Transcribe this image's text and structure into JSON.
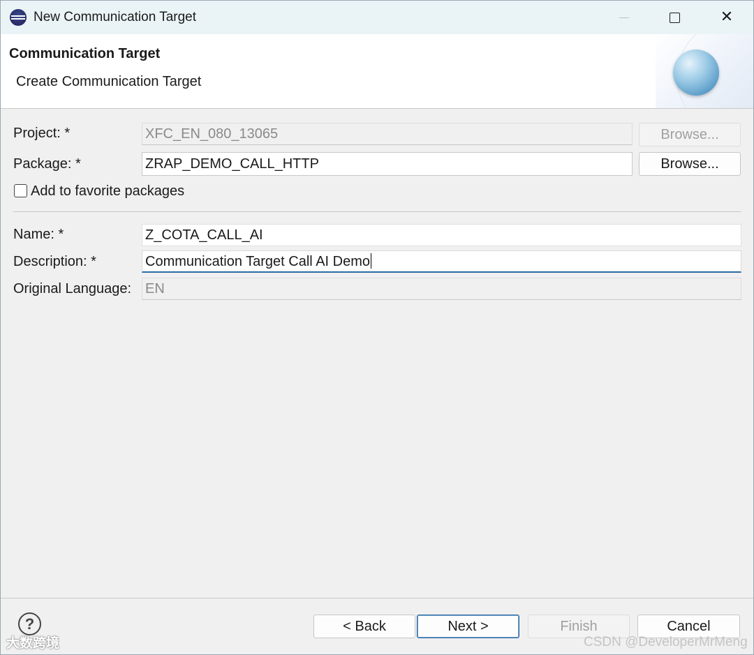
{
  "window": {
    "title": "New Communication Target",
    "icon": "eclipse-icon"
  },
  "banner": {
    "title": "Communication Target",
    "subtitle": "Create Communication Target",
    "image": "wizard-globe-icon"
  },
  "form": {
    "project": {
      "label": "Project: *",
      "value": "XFC_EN_080_13065",
      "enabled": false,
      "browse_label": "Browse..."
    },
    "package": {
      "label": "Package: *",
      "value": "ZRAP_DEMO_CALL_HTTP",
      "enabled": true,
      "browse_label": "Browse..."
    },
    "favorite": {
      "label": "Add to favorite packages",
      "checked": false
    },
    "name": {
      "label": "Name: *",
      "value": "Z_COTA_CALL_AI"
    },
    "description": {
      "label": "Description: *",
      "value": "Communication Target Call AI Demo"
    },
    "original_language": {
      "label": "Original Language:",
      "value": "EN",
      "enabled": false
    }
  },
  "footer": {
    "help": "?",
    "back_label": "< Back",
    "next_label": "Next >",
    "finish_label": "Finish",
    "cancel_label": "Cancel"
  },
  "watermarks": {
    "left": "大数跨境",
    "right": "CSDN @DeveloperMrMeng"
  },
  "colors": {
    "title_bar": "#eaf4f7",
    "focus_accent": "#2d6aa3",
    "dialog_bg": "#f0f0f0"
  }
}
